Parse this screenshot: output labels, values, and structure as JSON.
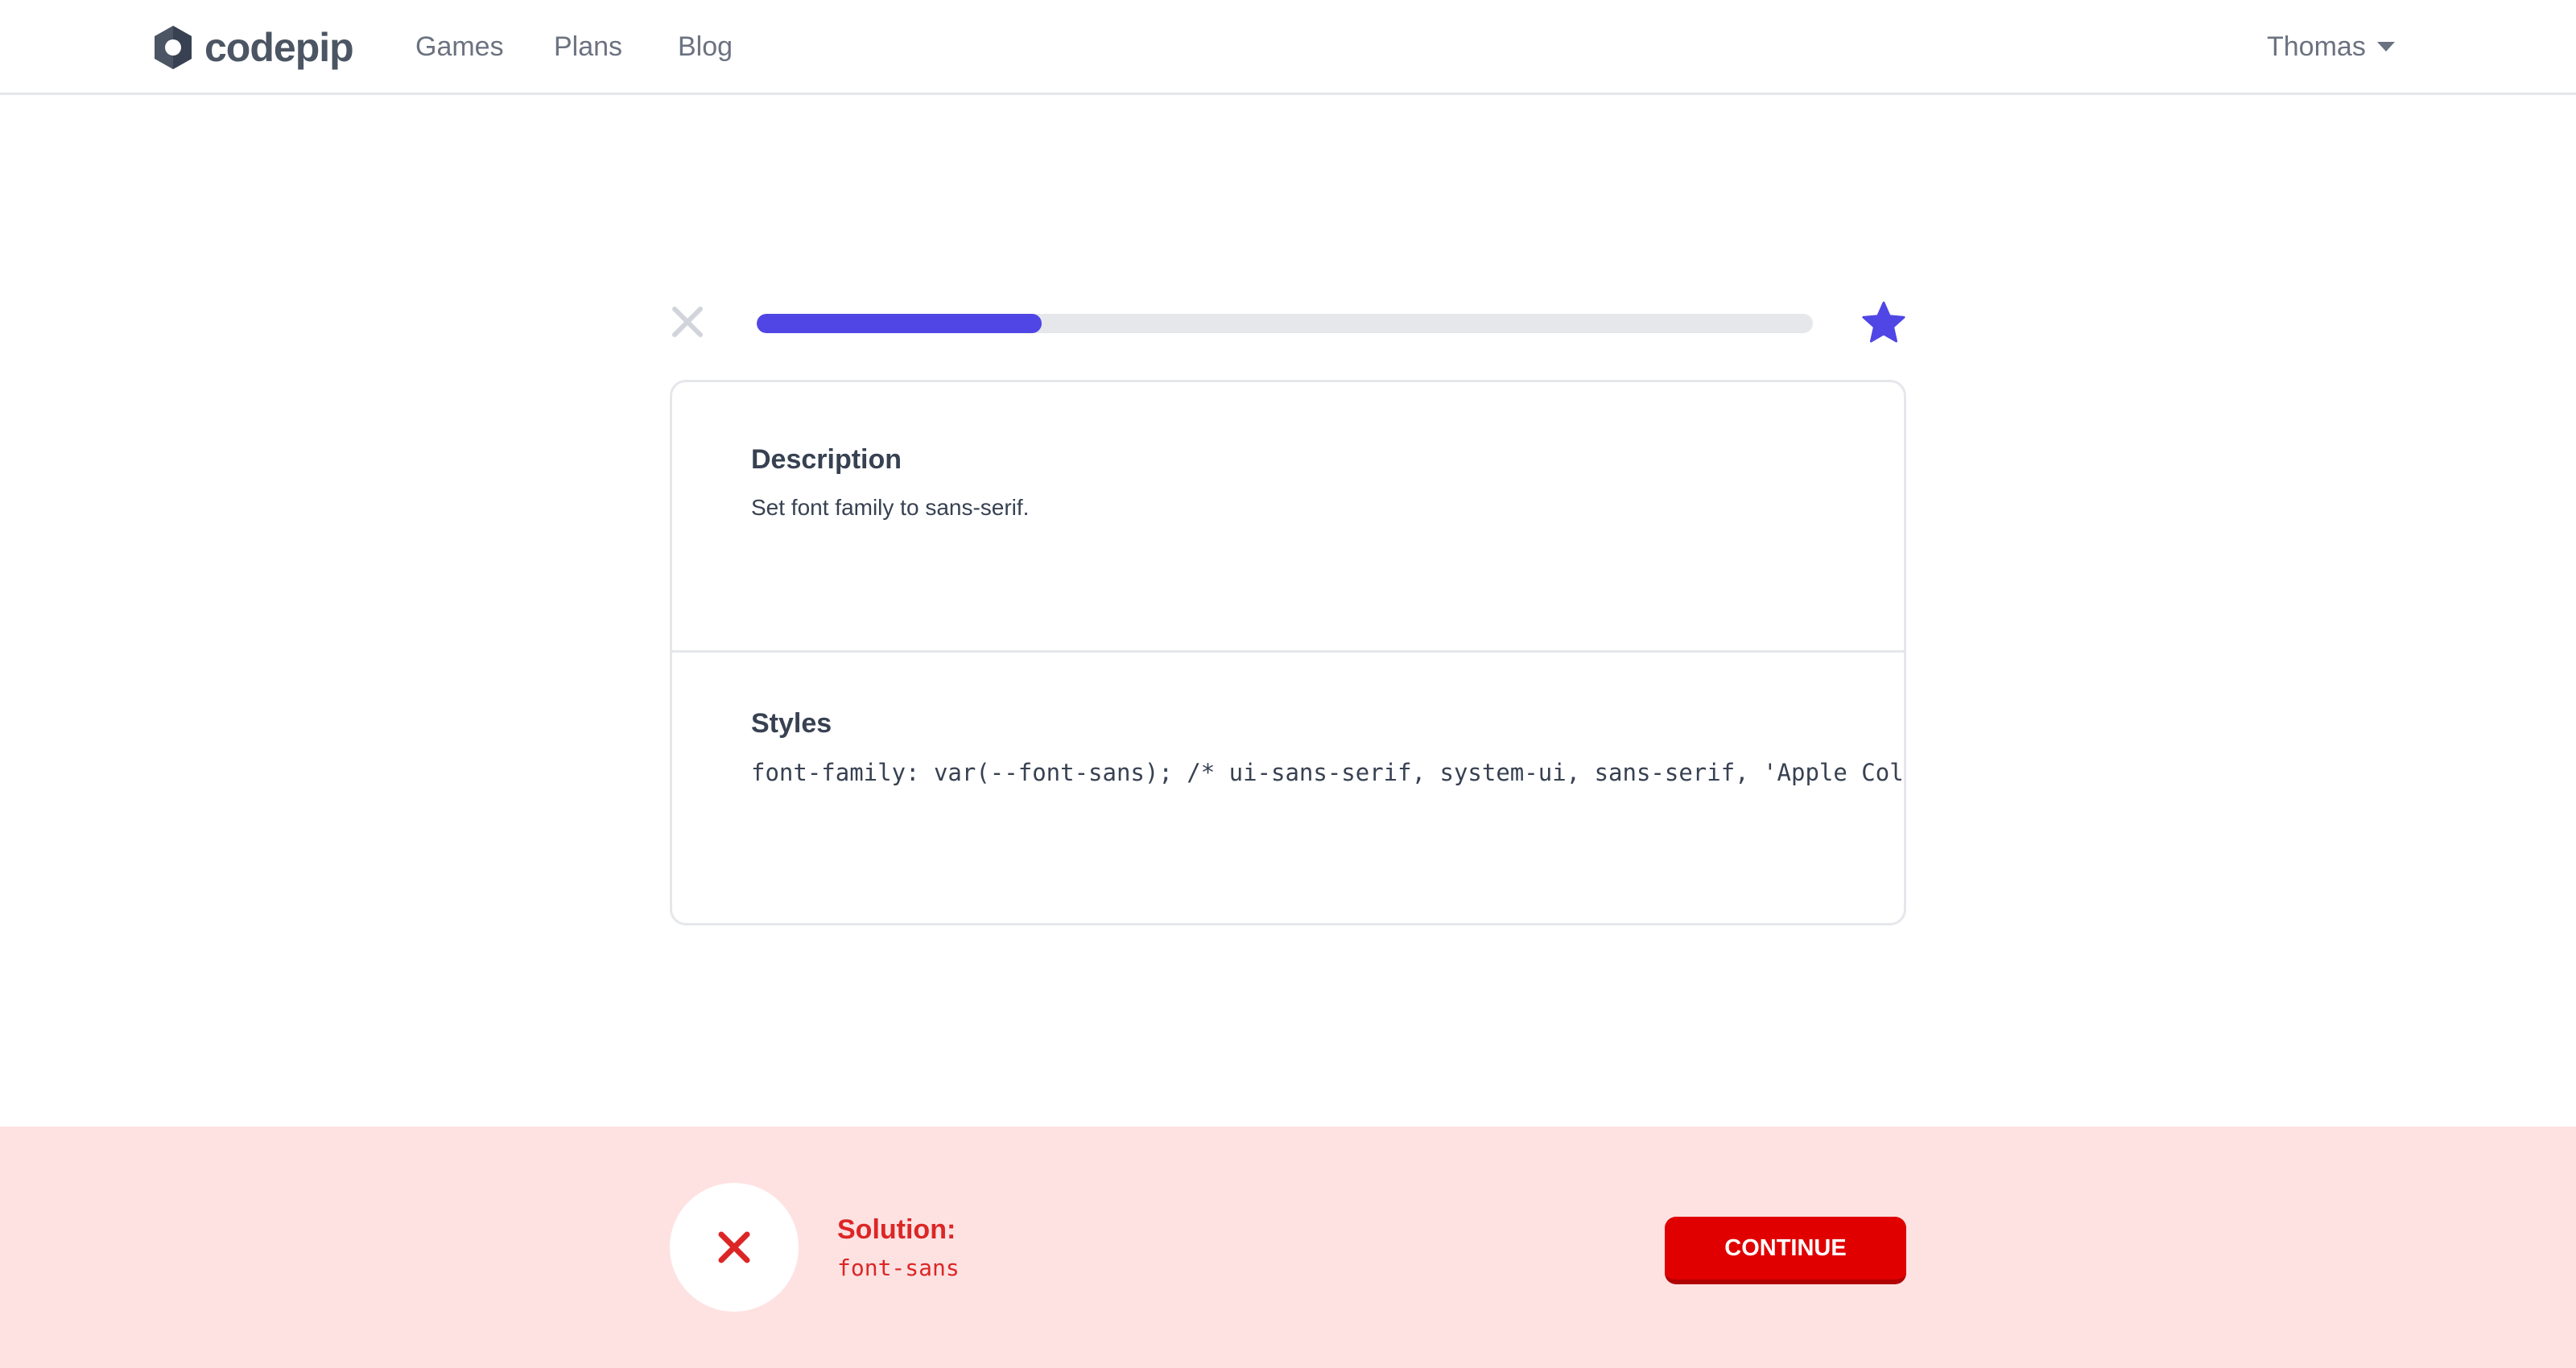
{
  "header": {
    "logo_text": "codepip",
    "nav": [
      {
        "label": "Games"
      },
      {
        "label": "Plans"
      },
      {
        "label": "Blog"
      }
    ],
    "user_name": "Thomas"
  },
  "lesson": {
    "progress_fraction": 0.27,
    "description_title": "Description",
    "description_text": "Set font family to sans-serif.",
    "styles_title": "Styles",
    "styles_code": "font-family: var(--font-sans); /* ui-sans-serif, system-ui, sans-serif, 'Apple Color Emoji', 'Segoe UI Emoji', 'Segoe UI Symbol', 'Noto Color Emoji' */"
  },
  "feedback": {
    "solution_label": "Solution:",
    "solution_value": "font-sans",
    "continue_label": "CONTINUE"
  },
  "colors": {
    "accent": "#4f46e5",
    "error": "#dc2626",
    "error_bg": "#fee2e2",
    "button": "#e00000"
  },
  "icons": {
    "close": "close-icon",
    "star": "star-icon",
    "result": "x-icon",
    "caret": "caret-down-icon"
  }
}
